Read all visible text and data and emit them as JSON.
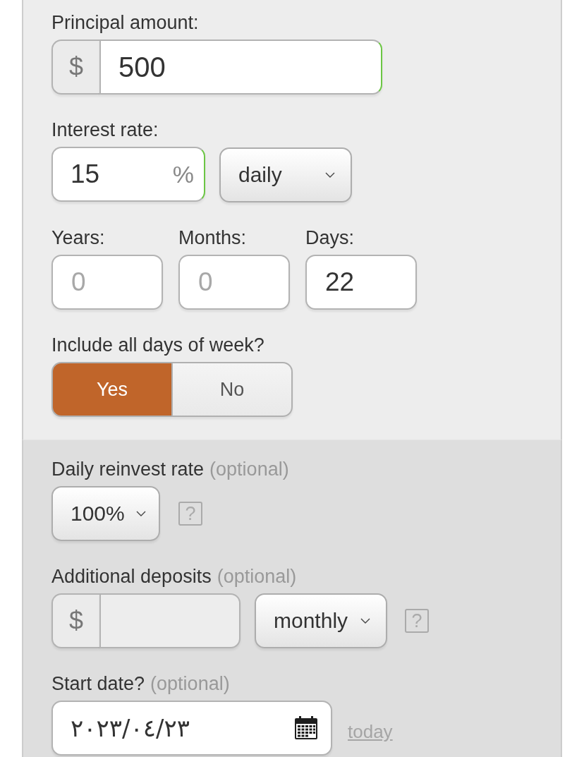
{
  "principal": {
    "label": "Principal amount:",
    "prefix": "$",
    "value": "500",
    "valid": true
  },
  "interest": {
    "label": "Interest rate:",
    "value": "15",
    "suffix": "%",
    "valid": true,
    "period": "daily"
  },
  "duration": [
    {
      "label": "Years:",
      "placeholder": "0"
    },
    {
      "label": "Months:",
      "placeholder": "0"
    },
    {
      "label": "Days:",
      "value": "22"
    }
  ],
  "week_toggle": {
    "label": "Include all days of week?",
    "options": [
      {
        "label": "Yes",
        "selected": true
      },
      {
        "label": "No",
        "selected": false
      }
    ]
  },
  "optional_section": {
    "reinvest": {
      "label": "Daily reinvest rate",
      "note": "(optional)",
      "value": "100%",
      "help": "?"
    },
    "deposits": {
      "label": "Additional deposits",
      "note": "(optional)",
      "prefix": "$",
      "frequency": "monthly",
      "help": "?"
    },
    "start_date": {
      "label": "Start date?",
      "note": "(optional)",
      "value": "٢٠٢٣/٠٤/٢٣",
      "link": "today"
    }
  }
}
